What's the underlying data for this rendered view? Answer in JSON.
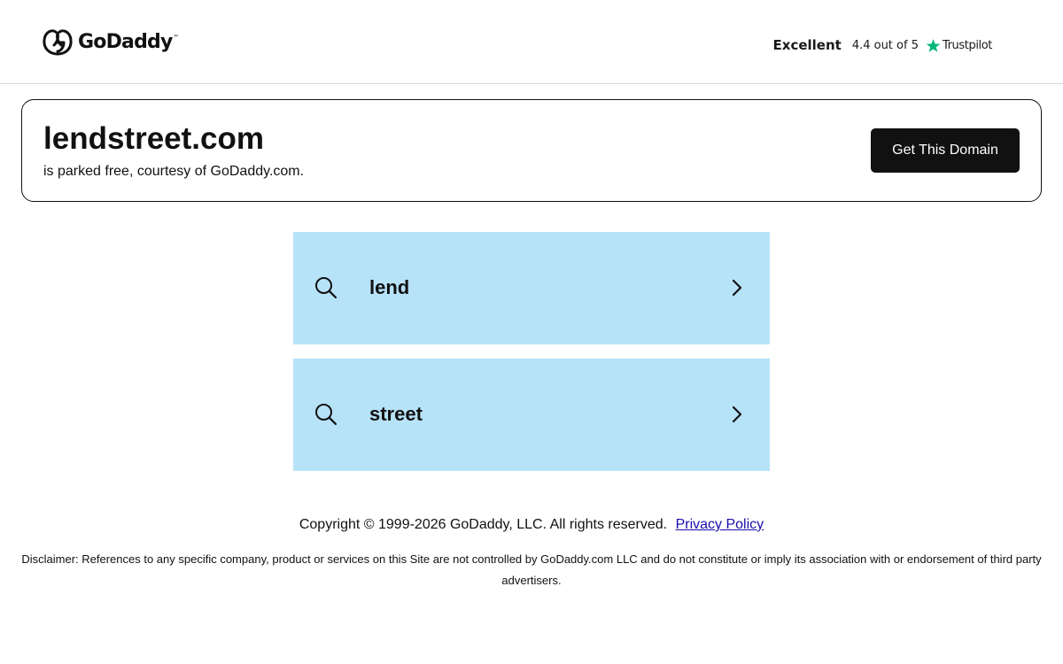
{
  "header": {
    "logo_text": "GoDaddy",
    "logo_tm": "™",
    "rating": {
      "label": "Excellent",
      "score_text": "4.4 out of 5",
      "provider": "Trustpilot",
      "star_color": "#00b67a"
    }
  },
  "domain": {
    "name": "lendstreet.com",
    "subtitle": "is parked free, courtesy of GoDaddy.com.",
    "cta_label": "Get This Domain"
  },
  "search_items": [
    {
      "label": "lend",
      "icon": "search-icon",
      "arrow": "chevron-right-icon"
    },
    {
      "label": "street",
      "icon": "search-icon",
      "arrow": "chevron-right-icon"
    }
  ],
  "footer": {
    "copyright": "Copyright © 1999-2026 GoDaddy, LLC. All rights reserved.",
    "privacy_label": "Privacy Policy",
    "disclaimer": "Disclaimer: References to any specific company, product or services on this Site are not controlled by GoDaddy.com LLC and do not constitute or imply its association with or endorsement of third party advertisers."
  },
  "colors": {
    "search_item_bg": "#b7e3f9",
    "button_bg": "#111111",
    "link": "#1a0dab"
  }
}
